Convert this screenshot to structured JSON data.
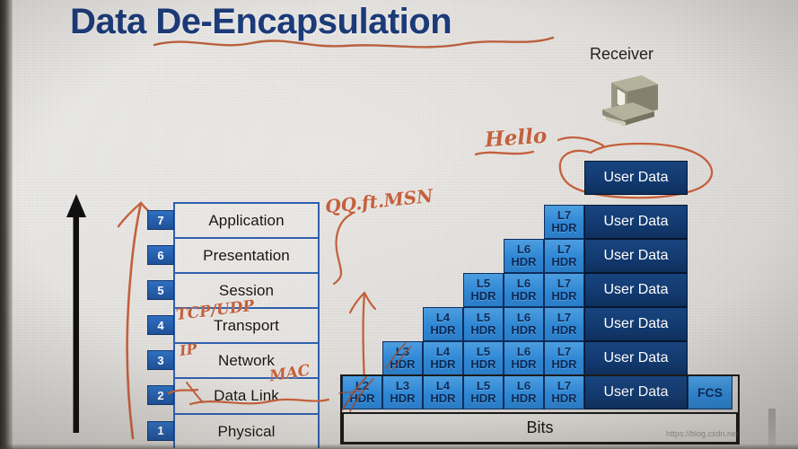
{
  "slide": {
    "title": "Data De-Encapsulation",
    "receiver_label": "Receiver",
    "receiver_icon": "computer-workstation-icon",
    "watermark": "https://blog.csdn.net",
    "colors": {
      "title_blue": "#1b3a78",
      "header_block_blue": "#2f87d4",
      "user_data_navy": "#123a6f",
      "bits_gray": "#d3d1cc",
      "handwriting_orange": "#c4603c",
      "layer_number_blue": "#2f6fc0"
    }
  },
  "osi_stack": {
    "layers": [
      {
        "number": "7",
        "name": "Application"
      },
      {
        "number": "6",
        "name": "Presentation"
      },
      {
        "number": "5",
        "name": "Session"
      },
      {
        "number": "4",
        "name": "Transport"
      },
      {
        "number": "3",
        "name": "Network"
      },
      {
        "number": "2",
        "name": "Data Link"
      },
      {
        "number": "1",
        "name": "Physical"
      }
    ]
  },
  "annotations": {
    "title_underline": "wavy-underline-squiggle",
    "black_arrow": "upward-arrow",
    "hand_arrow_left": "handwritten-upward-arrow",
    "hand_arrow_center": "handwritten-upward-arrow",
    "hello_circle": "handwritten-circle-around-user-data",
    "items": [
      {
        "id": "tcp-udp",
        "text": "TCP/UDP"
      },
      {
        "id": "ip",
        "text": "IP"
      },
      {
        "id": "mac",
        "text": "MAC"
      },
      {
        "id": "qq-ft-msn",
        "text": "QQ.ft.MSN"
      },
      {
        "id": "hello",
        "text": "Hello"
      }
    ]
  },
  "encapsulation": {
    "user_data_label": "User Data",
    "fcs_label": "FCS",
    "bits_label": "Bits",
    "rows": [
      {
        "id": "row-top-userdata",
        "headers": [],
        "user_data": true,
        "fcs": false
      },
      {
        "id": "row-l7",
        "headers": [
          "L7"
        ],
        "user_data": true,
        "fcs": false
      },
      {
        "id": "row-l6",
        "headers": [
          "L6",
          "L7"
        ],
        "user_data": true,
        "fcs": false
      },
      {
        "id": "row-l5",
        "headers": [
          "L5",
          "L6",
          "L7"
        ],
        "user_data": true,
        "fcs": false
      },
      {
        "id": "row-l4",
        "headers": [
          "L4",
          "L5",
          "L6",
          "L7"
        ],
        "user_data": true,
        "fcs": false
      },
      {
        "id": "row-l3",
        "headers": [
          "L3",
          "L4",
          "L5",
          "L6",
          "L7"
        ],
        "user_data": true,
        "fcs": false
      },
      {
        "id": "row-l2",
        "headers": [
          "L2",
          "L3",
          "L4",
          "L5",
          "L6",
          "L7"
        ],
        "user_data": true,
        "fcs": true
      }
    ],
    "header_suffix": "HDR"
  }
}
